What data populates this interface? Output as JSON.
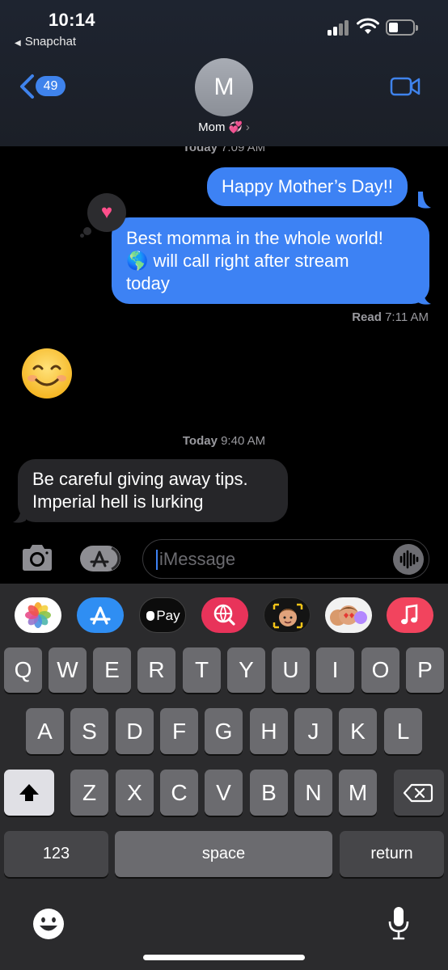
{
  "status_bar": {
    "time": "10:14",
    "back_app": "Snapchat"
  },
  "header": {
    "back_badge": "49",
    "avatar_initial": "M",
    "contact_name": "Mom",
    "contact_emoji": "💞",
    "video_icon": "video-camera-icon"
  },
  "messages": {
    "stamp1_day": "Today",
    "stamp1_time": "7:09 AM",
    "sent_1": "Happy Mother’s Day!!",
    "sent_2_line1": "Best momma in the whole world!",
    "sent_2_line2": " will call right after stream",
    "sent_2_line3": "today",
    "sent_2_emoji": "🌎",
    "tapback": "heart",
    "read_label": "Read",
    "read_time": "7:11 AM",
    "recv_emoji": "smiling-face-icon",
    "stamp2_day": "Today",
    "stamp2_time": "9:40 AM",
    "recv_line1": "Be careful giving away tips.",
    "recv_line2": "Imperial hell is lurking"
  },
  "input": {
    "placeholder": "iMessage"
  },
  "app_drawer": [
    {
      "name": "photos-app-icon"
    },
    {
      "name": "app-store-icon"
    },
    {
      "name": "apple-pay-icon",
      "label": "Pay"
    },
    {
      "name": "web-search-icon"
    },
    {
      "name": "memoji-icon"
    },
    {
      "name": "memoji-stickers-icon"
    },
    {
      "name": "music-app-icon"
    }
  ],
  "keyboard": {
    "row1": [
      "Q",
      "W",
      "E",
      "R",
      "T",
      "Y",
      "U",
      "I",
      "O",
      "P"
    ],
    "row2": [
      "A",
      "S",
      "D",
      "F",
      "G",
      "H",
      "J",
      "K",
      "L"
    ],
    "row3": [
      "Z",
      "X",
      "C",
      "V",
      "B",
      "N",
      "M"
    ],
    "numbers_key": "123",
    "space_key": "space",
    "return_key": "return"
  },
  "colors": {
    "sent_bubble": "#3d82f4",
    "received_bubble": "#262629",
    "accent": "#3f83ec"
  }
}
